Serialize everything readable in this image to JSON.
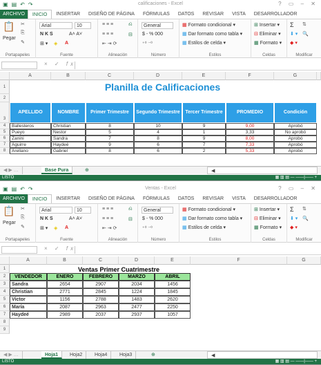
{
  "ribbon": {
    "tabs": [
      "ARCHIVO",
      "INICIO",
      "INSERTAR",
      "DISEÑO DE PÁGINA",
      "FÓRMULAS",
      "DATOS",
      "REVISAR",
      "VISTA",
      "DESARROLLADOR"
    ],
    "paste": "Pegar",
    "font_name": "Arial",
    "font_size": "10",
    "bold_italic_underline": "N K S",
    "grow_shrink": "A˄ A˅",
    "number_format": "General",
    "currency_row": "$ - % 000",
    "cond_format": "Formato condicional",
    "table_format": "Dar formato como tabla",
    "cell_styles": "Estilos de celda",
    "insert": "Insertar",
    "delete": "Eliminar",
    "format": "Formato",
    "sum": "Σ",
    "groups": [
      "Portapapeles",
      "Fuente",
      "Alineación",
      "Número",
      "Estilos",
      "Celdas",
      "Modificar"
    ],
    "fx": "fx",
    "formula_icons": "×  ✓"
  },
  "windows": [
    {
      "title": "calificaciones - Excel",
      "col_letters": [
        "A",
        "B",
        "C",
        "D",
        "E",
        "F",
        "G"
      ],
      "row_numbers": [
        "1",
        "2",
        "3",
        "4",
        "5",
        "6",
        "7",
        "8"
      ],
      "sheet_title": "Planilla de Calificaciones",
      "headers": [
        "APELLIDO",
        "NOMBRE",
        "Primer Trimestre",
        "Segundo Trimestre",
        "Tercer Trimestre",
        "PROMEDIO",
        "Condición"
      ],
      "rows": [
        [
          "Ballesteros",
          "Christian",
          "8",
          "10",
          "9",
          "9,00",
          "Aprobó"
        ],
        [
          "Pueyo",
          "Nestor",
          "5",
          "4",
          "1",
          "3,33",
          "No aprobó"
        ],
        [
          "Zanini",
          "Sandra",
          "7",
          "8",
          "9",
          "8,00",
          "Aprobó"
        ],
        [
          "Aguirre",
          "Haydeé",
          "9",
          "6",
          "7",
          "7,33",
          "Aprobó"
        ],
        [
          "Arellano",
          "Gabriel",
          "8",
          "6",
          "2",
          "5,33",
          "Aprobó"
        ]
      ],
      "sheets": [
        "Base Pura"
      ],
      "add_sheet": "⊕",
      "status": "LISTO"
    },
    {
      "title": "Ventas - Excel",
      "col_letters": [
        "A",
        "B",
        "C",
        "D",
        "E",
        "F",
        "G"
      ],
      "row_numbers": [
        "1",
        "2",
        "3",
        "4",
        "5",
        "6",
        "7",
        "8",
        "9"
      ],
      "sheet_title": "Ventas Primer Cuatrimestre",
      "headers": [
        "VENDEDOR",
        "ENERO",
        "FEBRERO",
        "MARZO",
        "ABRIL"
      ],
      "rows": [
        [
          "Sandra",
          "2654",
          "2907",
          "2034",
          "1456"
        ],
        [
          "Christian",
          "2771",
          "2845",
          "1224",
          "1845"
        ],
        [
          "Victor",
          "1156",
          "2788",
          "1483",
          "2620"
        ],
        [
          "María",
          "2087",
          "2963",
          "2477",
          "2250"
        ],
        [
          "Haydeé",
          "2989",
          "2037",
          "2937",
          "1057"
        ]
      ],
      "sheets": [
        "Hoja1",
        "Hoja2",
        "Hoja4",
        "Hoja3"
      ],
      "add_sheet": "⊕",
      "status": "LISTO"
    }
  ],
  "colors": {
    "excel_green": "#217346",
    "header_blue": "#2e9fe6",
    "header_green": "#9be59b",
    "red_value": "#e02020"
  }
}
